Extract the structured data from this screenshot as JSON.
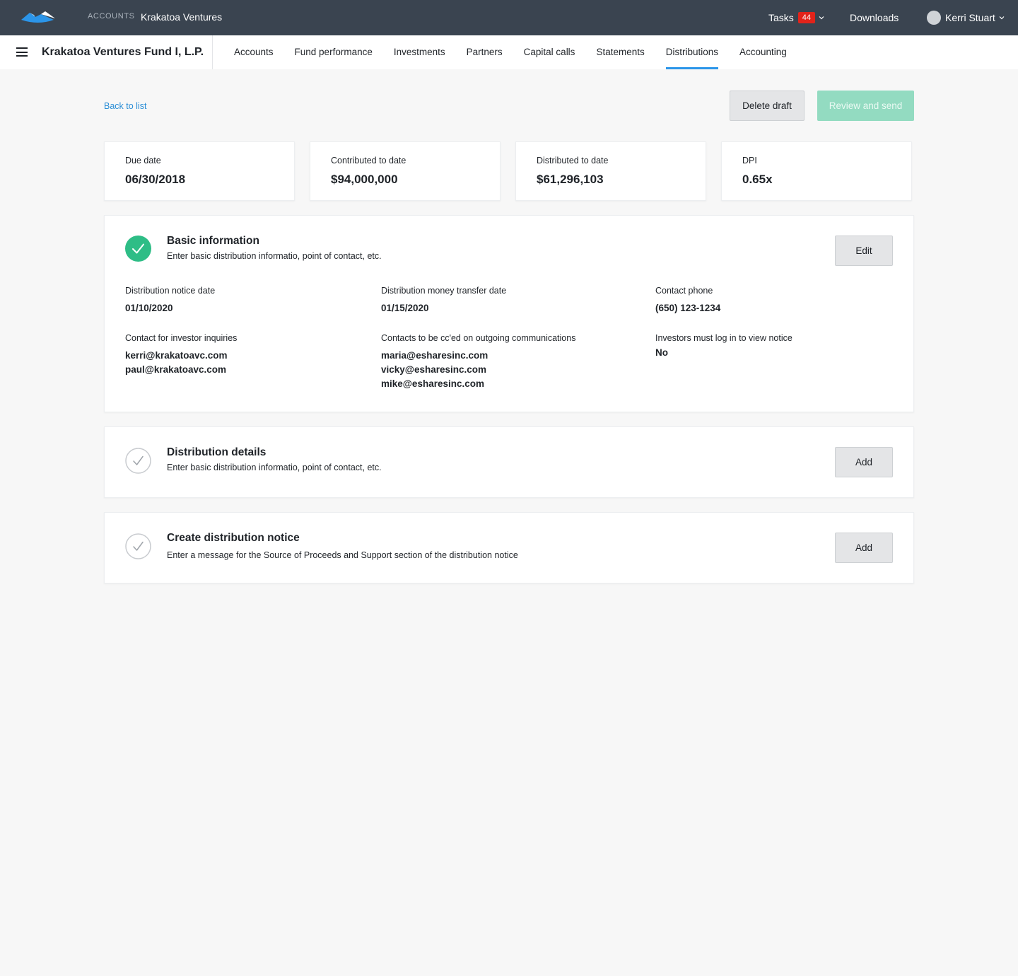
{
  "topbar": {
    "crumb_label": "ACCOUNTS",
    "crumb_value": "Krakatoa Ventures",
    "tasks_label": "Tasks",
    "tasks_count": "44",
    "downloads_label": "Downloads",
    "user_name": "Kerri Stuart"
  },
  "subnav": {
    "fund_name": "Krakatoa Ventures Fund I, L.P.",
    "tabs": [
      {
        "label": "Accounts"
      },
      {
        "label": "Fund performance"
      },
      {
        "label": "Investments"
      },
      {
        "label": "Partners"
      },
      {
        "label": "Capital calls"
      },
      {
        "label": "Statements"
      },
      {
        "label": "Distributions"
      },
      {
        "label": "Accounting"
      }
    ]
  },
  "actions": {
    "back_label": "Back to list",
    "delete_label": "Delete draft",
    "review_label": "Review and send"
  },
  "stats": [
    {
      "label": "Due date",
      "value": "06/30/2018"
    },
    {
      "label": "Contributed to date",
      "value": "$94,000,000"
    },
    {
      "label": "Distributed to date",
      "value": "$61,296,103"
    },
    {
      "label": "DPI",
      "value": "0.65x"
    }
  ],
  "basic": {
    "title": "Basic information",
    "subtitle": "Enter basic distribution informatio, point of contact, etc.",
    "button": "Edit",
    "fields": {
      "notice_date": {
        "label": "Distribution notice date",
        "value": "01/10/2020"
      },
      "transfer_date": {
        "label": "Distribution money transfer date",
        "value": "01/15/2020"
      },
      "phone": {
        "label": "Contact phone",
        "value": "(650) 123-1234"
      },
      "inquiries": {
        "label": "Contact for investor inquiries",
        "values": [
          "kerri@krakatoavc.com",
          "paul@krakatoavc.com"
        ]
      },
      "ccd": {
        "label": "Contacts to be cc'ed on outgoing communications",
        "values": [
          "maria@esharesinc.com",
          "vicky@esharesinc.com",
          "mike@esharesinc.com"
        ]
      },
      "login": {
        "label": "Investors must log in to view notice",
        "value": "No"
      }
    }
  },
  "details": {
    "title": "Distribution details",
    "subtitle": "Enter basic distribution informatio, point of contact, etc.",
    "button": "Add"
  },
  "notice": {
    "title": "Create distribution notice",
    "subtitle": "Enter a message for the Source of Proceeds and Support section of the distribution notice",
    "button": "Add"
  }
}
